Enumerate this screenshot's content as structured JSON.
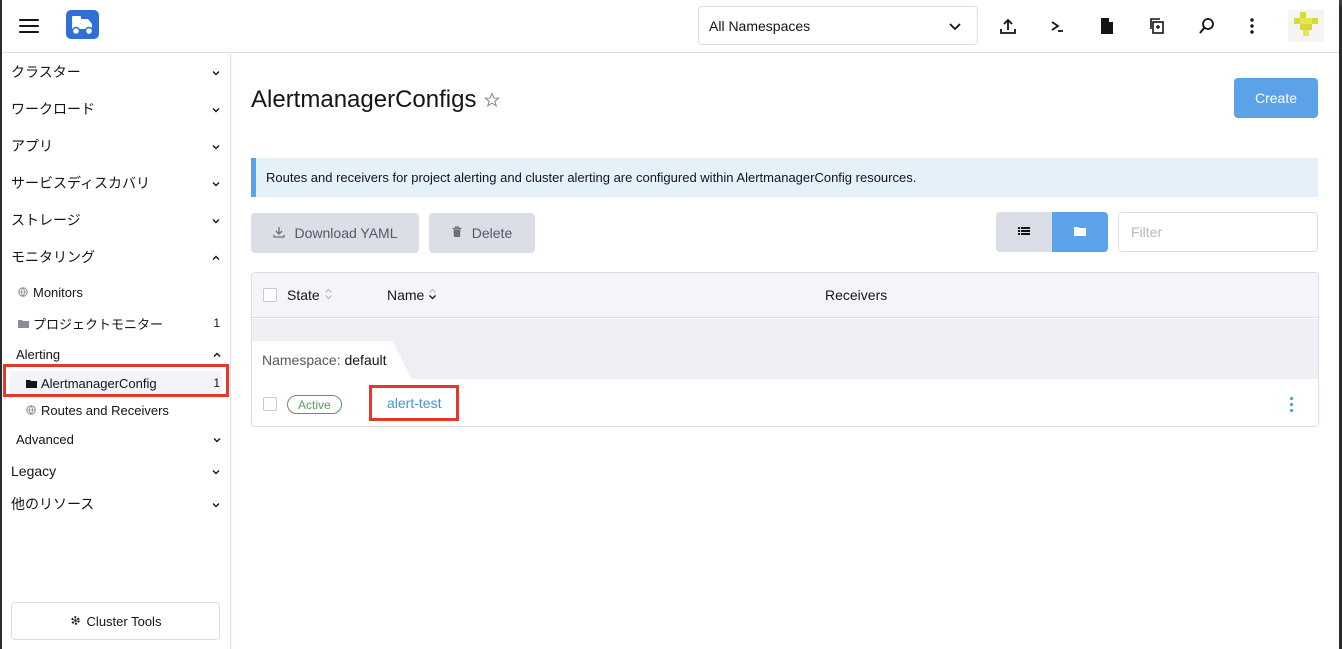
{
  "header": {
    "namespace_select": "All Namespaces",
    "icons": [
      "import-yaml-icon",
      "kubectl-shell-icon",
      "kubeconfig-file-icon",
      "copy-kubeconfig-icon",
      "resource-search-icon",
      "more-actions-icon"
    ]
  },
  "sidebar": {
    "groups": {
      "cluster": "クラスター",
      "workload": "ワークロード",
      "apps": "アプリ",
      "service_discovery": "サービスディスカバリ",
      "storage": "ストレージ",
      "monitoring": "モニタリング",
      "legacy": "Legacy",
      "other": "他のリソース"
    },
    "monitoring_items": {
      "monitors": "Monitors",
      "project_monitors": "プロジェクトモニター",
      "project_monitors_count": "1"
    },
    "alerting": {
      "label": "Alerting",
      "alertmanager_config": "AlertmanagerConfig",
      "alertmanager_config_count": "1",
      "routes_receivers": "Routes and Receivers"
    },
    "advanced": "Advanced",
    "cluster_tools": "Cluster Tools"
  },
  "main": {
    "title": "AlertmanagerConfigs",
    "create_label": "Create",
    "banner": "Routes and receivers for project alerting and cluster alerting are configured within AlertmanagerConfig resources.",
    "download_yaml_label": "Download YAML",
    "delete_label": "Delete",
    "filter_placeholder": "Filter",
    "table": {
      "columns": {
        "state": "State",
        "name": "Name",
        "receivers": "Receivers"
      },
      "group_prefix": "Namespace:",
      "group_value": "default",
      "rows": [
        {
          "state": "Active",
          "name": "alert-test",
          "receivers": ""
        }
      ]
    }
  },
  "colors": {
    "primary": "#5ba2e8",
    "link": "#3d98d3",
    "success": "#5d995d",
    "highlight": "#e3392b"
  }
}
